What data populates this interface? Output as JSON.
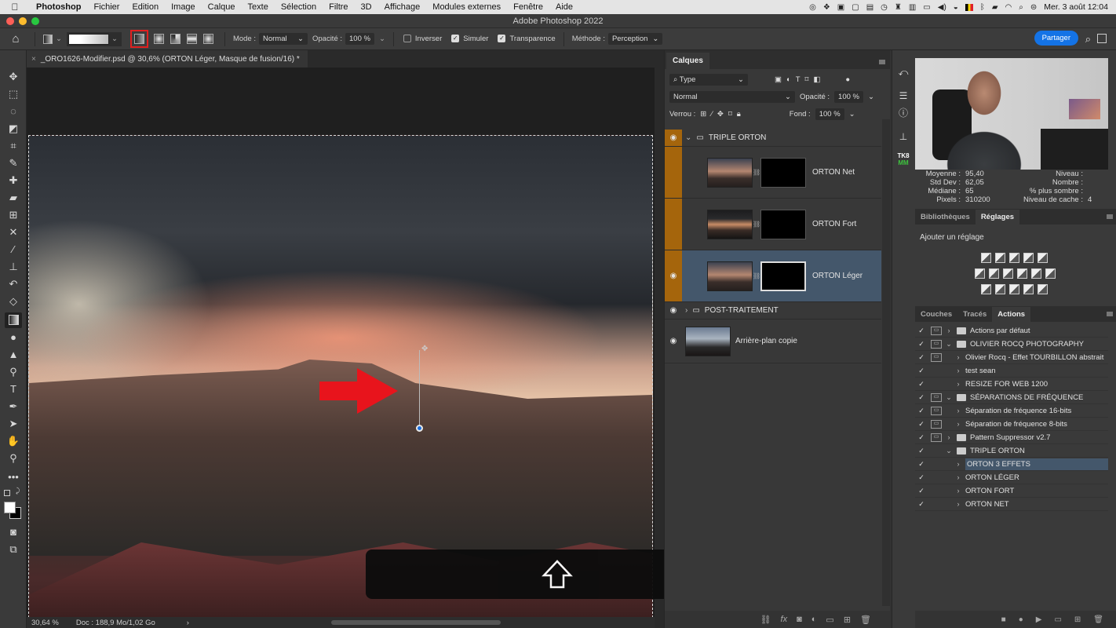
{
  "menubar": {
    "apple_icon": "apple-icon",
    "items": [
      "Photoshop",
      "Fichier",
      "Edition",
      "Image",
      "Calque",
      "Texte",
      "Sélection",
      "Filtre",
      "3D",
      "Affichage",
      "Modules externes",
      "Fenêtre",
      "Aide"
    ],
    "clock": "Mer. 3 août  12:04"
  },
  "window": {
    "title": "Adobe Photoshop 2022"
  },
  "options": {
    "mode_label": "Mode :",
    "mode_value": "Normal",
    "opacity_label": "Opacité :",
    "opacity_value": "100 %",
    "inverser_label": "Inverser",
    "inverser_checked": false,
    "simuler_label": "Simuler",
    "simuler_checked": true,
    "transparence_label": "Transparence",
    "transparence_checked": true,
    "methode_label": "Méthode :",
    "methode_value": "Perception",
    "share_label": "Partager",
    "gradient_types": [
      "linear",
      "radial",
      "angle",
      "reflected",
      "diamond"
    ],
    "selected_gradient_type": "linear"
  },
  "document": {
    "tab_title": "_ORO1626-Modifier.psd @ 30,6% (ORTON Léger, Masque de fusion/16) *",
    "zoom": "30,64 %",
    "doc_size": "Doc : 188,9 Mo/1,02 Go"
  },
  "layers_panel": {
    "title": "Calques",
    "filter_value": "Type",
    "blend_mode": "Normal",
    "opacity_label": "Opacité :",
    "opacity_value": "100 %",
    "lock_label": "Verrou :",
    "fill_label": "Fond :",
    "fill_value": "100 %",
    "layers": [
      {
        "name": "TRIPLE ORTON",
        "type": "group",
        "visible": true,
        "expanded": true
      },
      {
        "name": "ORTON Net",
        "type": "layer",
        "visible": false,
        "has_mask": true
      },
      {
        "name": "ORTON Fort",
        "type": "layer",
        "visible": false,
        "has_mask": true
      },
      {
        "name": "ORTON Léger",
        "type": "layer",
        "visible": true,
        "has_mask": true,
        "selected": true
      },
      {
        "name": "POST-TRAITEMENT",
        "type": "group",
        "visible": true,
        "expanded": false
      },
      {
        "name": "Arrière-plan copie",
        "type": "layer",
        "visible": true,
        "has_mask": false
      }
    ]
  },
  "histogram": {
    "moyenne_label": "Moyenne :",
    "moyenne": "95,40",
    "stddev_label": "Std Dev :",
    "stddev": "62,05",
    "mediane_label": "Médiane :",
    "mediane": "65",
    "pixels_label": "Pixels :",
    "pixels": "310200",
    "niveau_label": "Niveau :",
    "niveau": "",
    "nombre_label": "Nombre :",
    "nombre": "",
    "sombre_label": "% plus sombre :",
    "sombre": "",
    "cache_label": "Niveau de cache :",
    "cache": "4"
  },
  "adjust_tabs": {
    "bibliotheques": "Bibliothèques",
    "reglages": "Réglages",
    "hint": "Ajouter un réglage"
  },
  "actions_tabs": {
    "couches": "Couches",
    "traces": "Tracés",
    "actions": "Actions"
  },
  "actions": [
    {
      "name": "Actions par défaut",
      "level": 0,
      "folder": true,
      "expanded": false,
      "dialog": true
    },
    {
      "name": "OLIVIER ROCQ PHOTOGRAPHY",
      "level": 0,
      "folder": true,
      "expanded": true,
      "dialog": true
    },
    {
      "name": "Olivier Rocq - Effet TOURBILLON abstrait",
      "level": 1,
      "folder": false,
      "dialog": true
    },
    {
      "name": "test sean",
      "level": 1,
      "folder": false,
      "dialog": false
    },
    {
      "name": "RESIZE FOR WEB 1200",
      "level": 1,
      "folder": false,
      "dialog": false
    },
    {
      "name": "SÉPARATIONS DE FRÉQUENCE",
      "level": 0,
      "folder": true,
      "expanded": true,
      "dialog": true
    },
    {
      "name": "Séparation de fréquence 16-bits",
      "level": 1,
      "folder": false,
      "dialog": true
    },
    {
      "name": "Séparation de fréquence 8-bits",
      "level": 1,
      "folder": false,
      "dialog": true
    },
    {
      "name": "Pattern Suppressor v2.7",
      "level": 0,
      "folder": true,
      "expanded": false,
      "dialog": true
    },
    {
      "name": "TRIPLE ORTON",
      "level": 0,
      "folder": true,
      "expanded": true,
      "dialog": false
    },
    {
      "name": "ORTON 3 EFFETS",
      "level": 1,
      "folder": false,
      "dialog": false,
      "selected": true
    },
    {
      "name": "ORTON LÉGER",
      "level": 1,
      "folder": false,
      "dialog": false
    },
    {
      "name": "ORTON FORT",
      "level": 1,
      "folder": false,
      "dialog": false
    },
    {
      "name": "ORTON NET",
      "level": 1,
      "folder": false,
      "dialog": false
    }
  ],
  "colors": {
    "accent": "#1473e6",
    "group_orange": "#a5650c",
    "selection": "#44576b",
    "highlight_red": "#e02020"
  }
}
